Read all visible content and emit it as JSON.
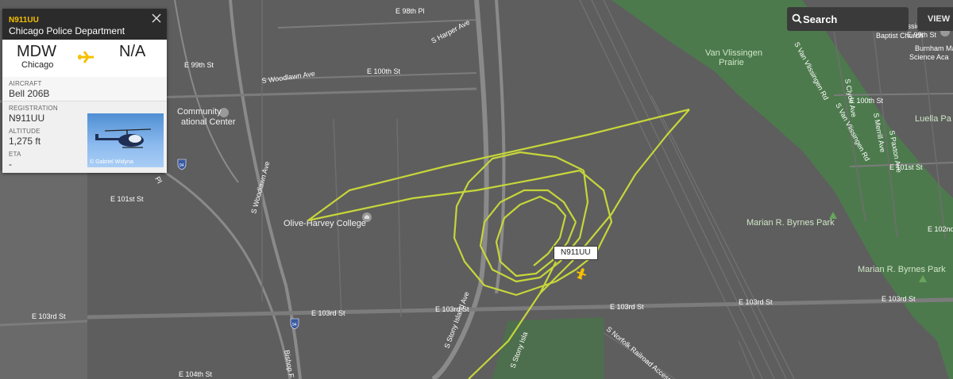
{
  "map": {
    "streets": {
      "e_98th_pl": "E 98th Pl",
      "s_harper_ave": "S Harper Ave",
      "e_99th_st_left": "E 99th St",
      "s_woodlawn_ave_top": "S Woodlawn Ave",
      "e_100th_st": "E 100th St",
      "s_woodlawn_ave_vert": "S Woodlawn Ave",
      "e_101st_st": "E 101st St",
      "e_103rd_st_left": "E 103rd St",
      "e_103rd_st_mid": "E 103rd St",
      "e_103rd_st_mid2": "E 103rd St",
      "e_103rd_st_right": "E 103rd St",
      "s_stony_island_ave": "S Stony Island Ave",
      "s_stony_island_ave2": "S Stony Isla",
      "s_norfolk_railroad": "S Norfolk Railroad Access Rd",
      "e_104th_st": "E 104th St",
      "bishop": "Bishop F",
      "s_van_vlissingen_rd": "S Van Vlissingen Rd",
      "s_van_vlissingen_rd2": "S Van Vlissingen Rd",
      "e_100th_st_right": "E 100th St",
      "e_99th_st_right": "E 99th St",
      "e_101st_st_right": "E 101st St",
      "e_102nd_st": "E 102nd",
      "e_103rd_st_far": "E 103rd St",
      "s_merrill_ave": "S Merrill Ave",
      "s_chyde_ave": "S Clyde Ave",
      "s_paxton_ave": "S Paxton Ave",
      "i94_a": "94",
      "i94_b": "94",
      "pl": "Pl"
    },
    "pois": {
      "community_center_1": "Community",
      "community_center_2": "ational Center",
      "olive_harvey": "Olive-Harvey College",
      "van_vlissingen_1": "Van Vlissingen",
      "van_vlissingen_2": "Prairie",
      "marian_byrnes_1": "Marian R. Byrnes Park",
      "marian_byrnes_2": "Marian R. Byrnes Park",
      "church_1": "Mt Sinai Mission",
      "church_2": "Baptist Church",
      "burnham_1": "Burnham Mat",
      "burnham_2": "Science Aca",
      "luella": "Luella Pa"
    },
    "colors": {
      "background": "#5c5c5c",
      "park": "#4d7a4d",
      "track": "#c6d63a"
    }
  },
  "flight_panel": {
    "callsign": "N911UU",
    "operator": "Chicago Police Department",
    "origin_code": "MDW",
    "origin_city": "Chicago",
    "destination_code": "N/A",
    "aircraft_label": "AIRCRAFT",
    "aircraft_value": "Bell 206B",
    "registration_label": "REGISTRATION",
    "registration_value": "N911UU",
    "altitude_label": "ALTITUDE",
    "altitude_value": "1,275 ft",
    "eta_label": "ETA",
    "eta_value": "-",
    "photo_credit": "© Gabriel Widyna",
    "accent_color": "#f6c000"
  },
  "toolbar": {
    "search_label": "Search",
    "view_label": "VIEW"
  },
  "aircraft_tag": "N911UU"
}
